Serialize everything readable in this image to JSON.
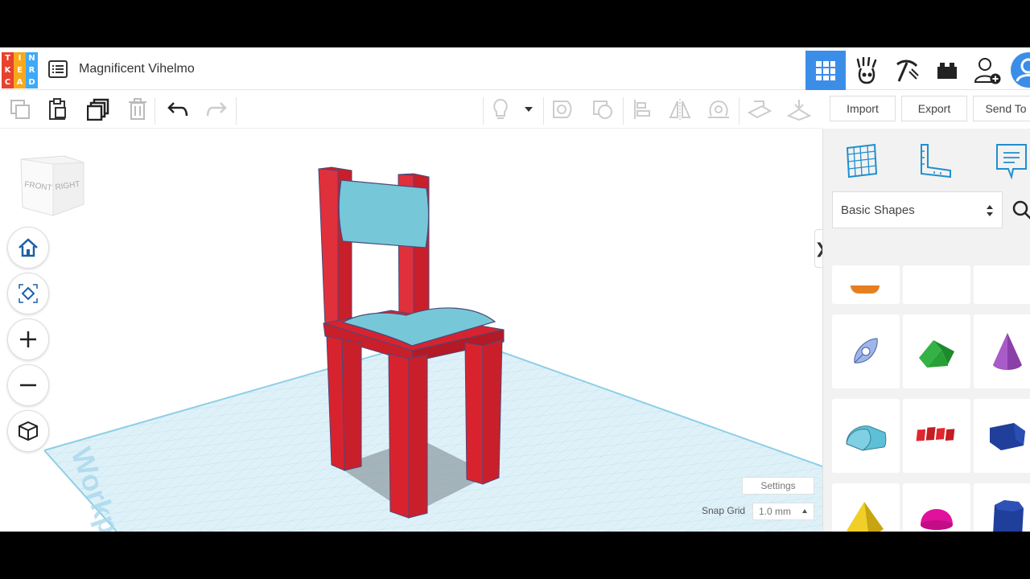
{
  "app": {
    "logo_letters": [
      "T",
      "I",
      "N",
      "K",
      "E",
      "R",
      "C",
      "A",
      "D"
    ],
    "logo_colors": [
      "#e8412d",
      "#f7a81b",
      "#3fa9f5",
      "#e8412d",
      "#f7a81b",
      "#3fa9f5",
      "#e8412d",
      "#f7a81b",
      "#3fa9f5"
    ],
    "design_title": "Magnificent Vihelmo",
    "accent_color": "#3b8ee8"
  },
  "topbar": {
    "icons": [
      "grid-view-icon",
      "tinkerers-icon",
      "pickaxe-icon",
      "bricks-icon",
      "add-user-icon",
      "profile-avatar"
    ]
  },
  "toolbar": {
    "buttons": [
      "copy-icon",
      "paste-icon",
      "duplicate-icon",
      "delete-icon",
      "undo-icon",
      "redo-icon",
      "lightbulb-icon",
      "group-icon",
      "ungroup-icon",
      "align-icon",
      "mirror-icon",
      "cruise-icon",
      "workplane-tool-icon",
      "ruler-tool-icon"
    ]
  },
  "actions": {
    "import_label": "Import",
    "export_label": "Export",
    "send_label": "Send To"
  },
  "viewcube": {
    "front": "FRONT",
    "right": "RIGHT"
  },
  "workplane": {
    "watermark": "Workplane",
    "settings_label": "Settings",
    "snap_grid_label": "Snap Grid",
    "snap_grid_value": "1.0 mm"
  },
  "panel": {
    "collapse_glyph": "❯",
    "category": "Basic Shapes",
    "shapes": [
      "Paraboloid shape",
      "Wedge",
      "Cone",
      "Half Cylinder",
      "Text",
      "Polygon",
      "Pyramid",
      "Half Sphere",
      "Hexagonal Prism"
    ],
    "shape_colors": {
      "paraboloid": "#8aa7e8",
      "wedge": "#2fa83a",
      "cone": "#8b3fa8",
      "half_cylinder": "#5cc0d6",
      "text": "#e0262e",
      "polygon": "#1f3f9b",
      "pyramid": "#e9c719",
      "half_sphere": "#e0129c",
      "hex_prism": "#1f3f9b"
    }
  },
  "model": {
    "frame_color": "#d8232e",
    "cushion_color": "#76c8d8"
  }
}
